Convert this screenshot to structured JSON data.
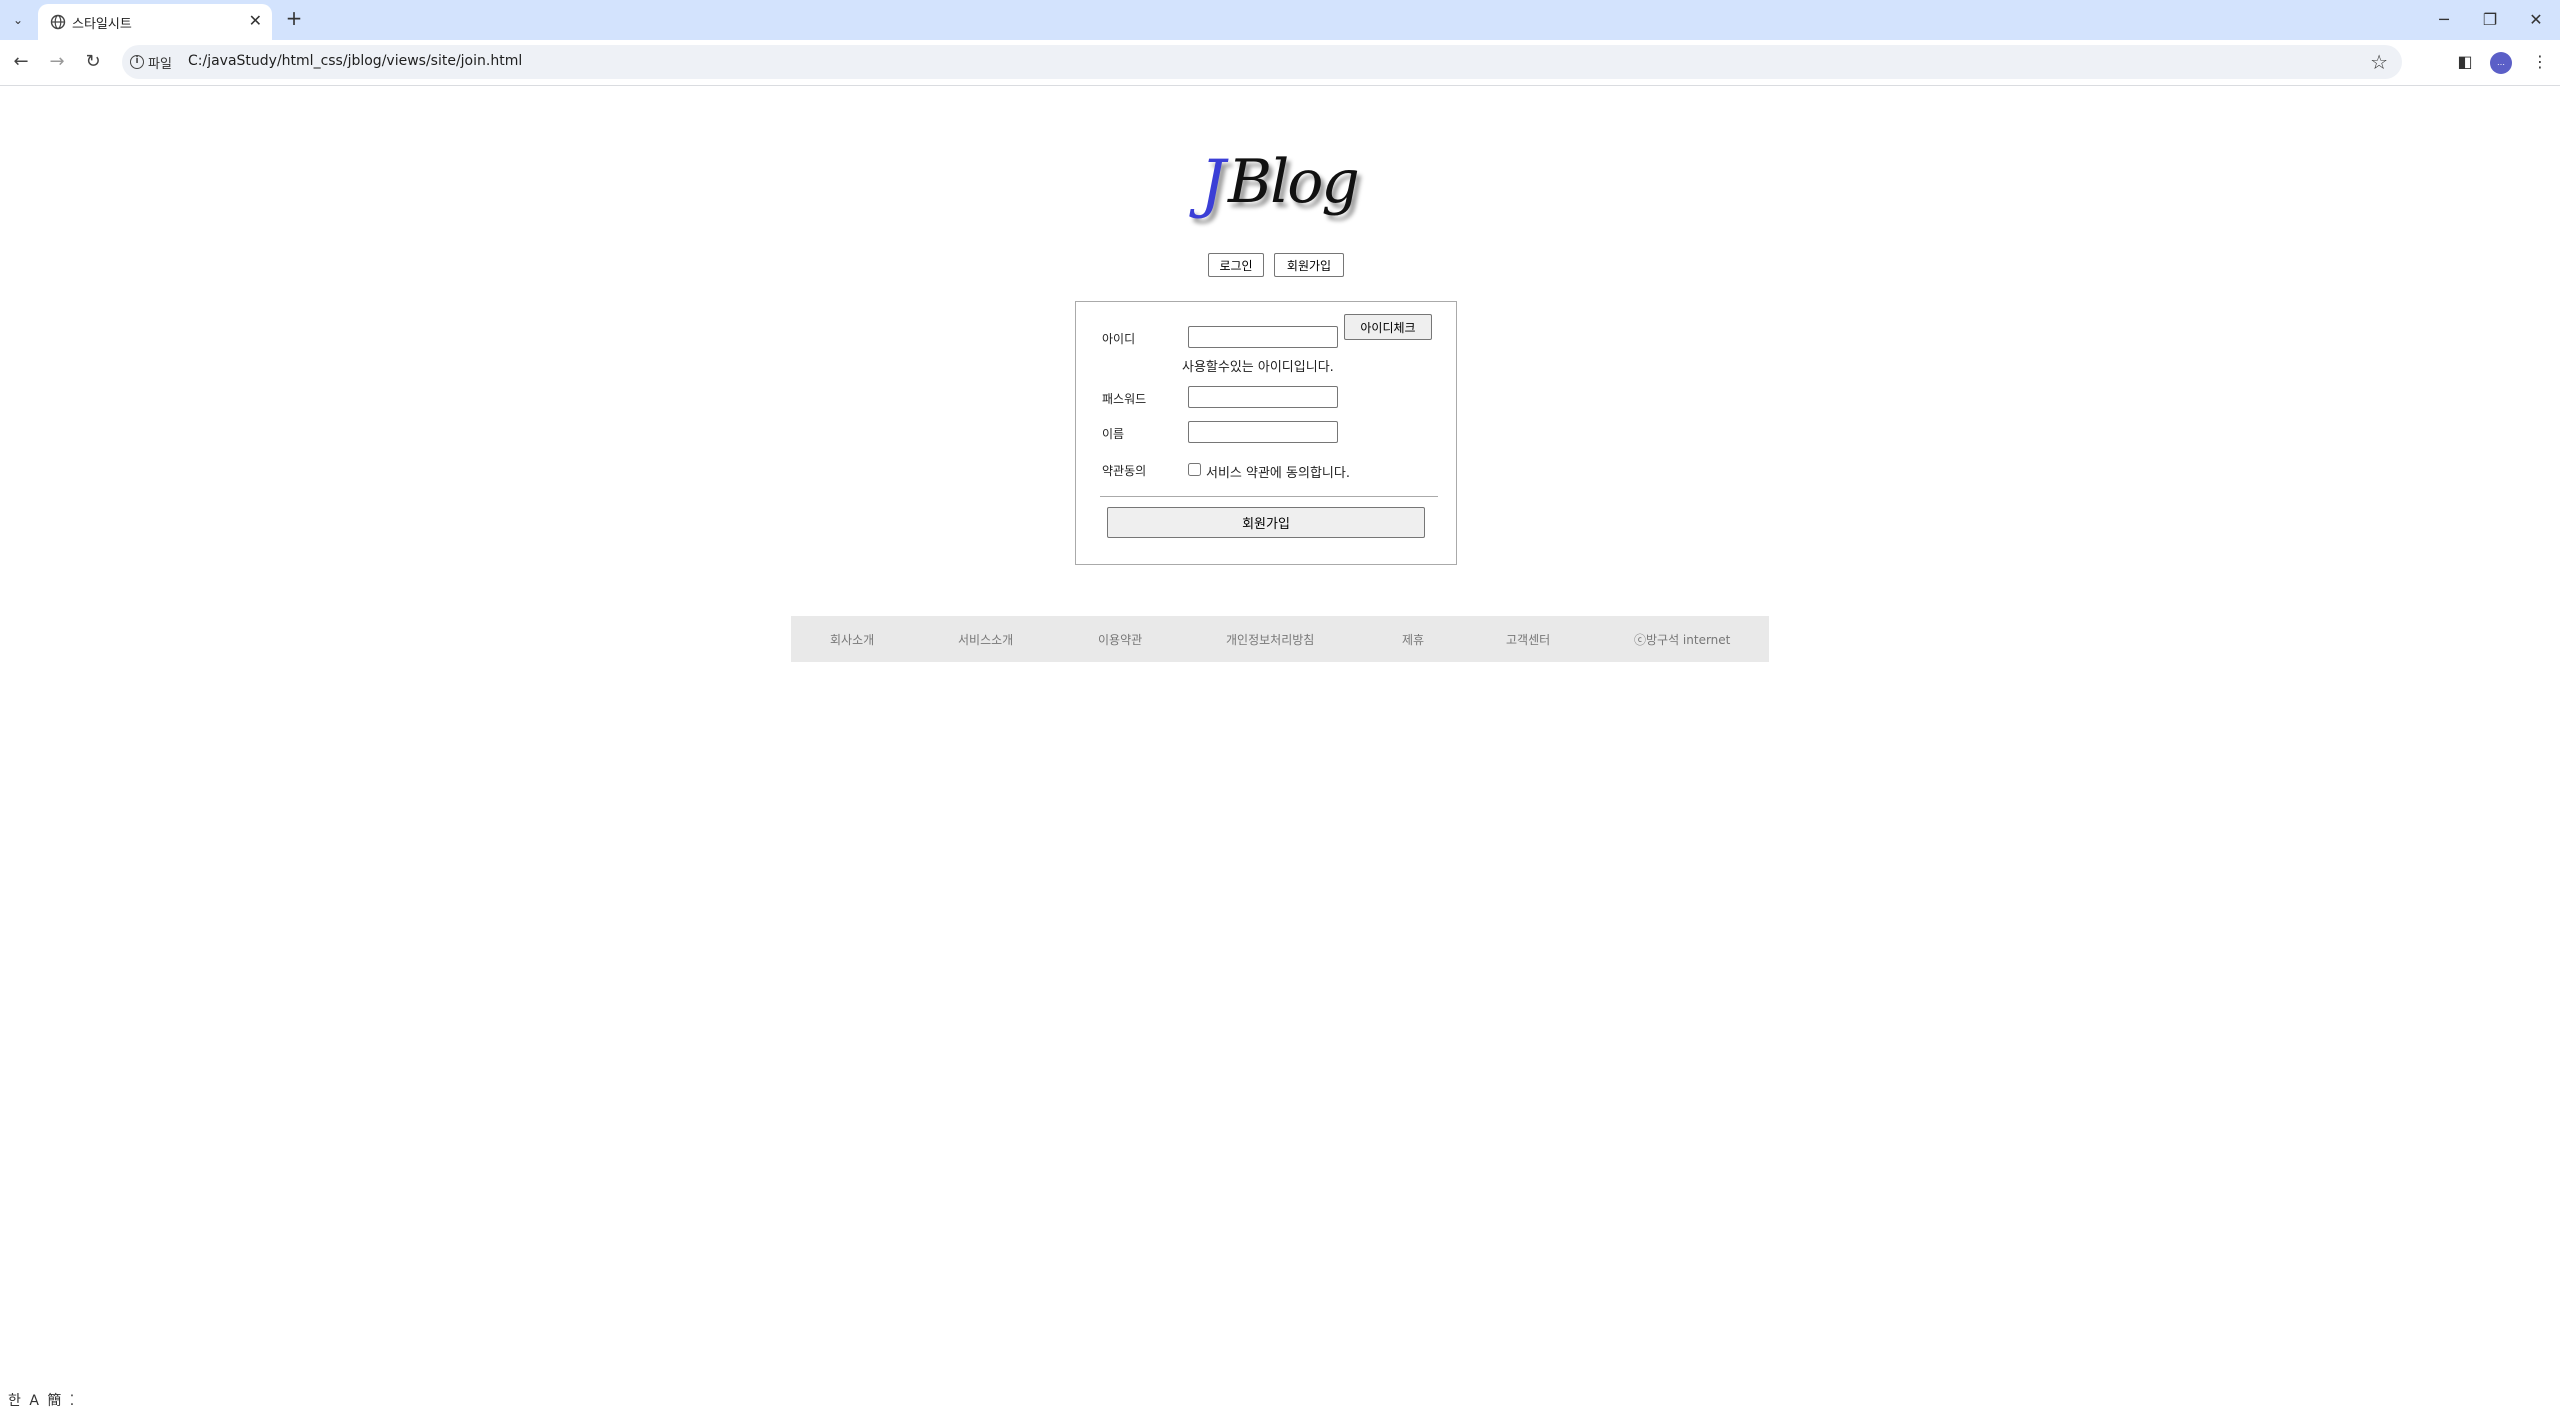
{
  "browser": {
    "tab_title": "스타일시트",
    "tab_close": "✕",
    "new_tab": "+",
    "scheme_label": "파일",
    "url": "C:/javaStudy/html_css/jblog/views/site/join.html",
    "profile_text": "…",
    "window_minimize": "─",
    "window_restore": "❐",
    "window_close": "✕"
  },
  "logo": {
    "j": "J",
    "rest": "Blog"
  },
  "menu": {
    "login": "로그인",
    "join": "회원가입"
  },
  "form": {
    "id_label": "아이디",
    "id_value": "",
    "id_check_button": "아이디체크",
    "id_message": "사용할수있는 아이디입니다.",
    "password_label": "패스워드",
    "password_value": "",
    "name_label": "이름",
    "name_value": "",
    "terms_label": "약관동의",
    "terms_checked": false,
    "terms_text": "서비스 약관에 동의합니다.",
    "submit_button": "회원가입"
  },
  "footer": {
    "items": [
      "회사소개",
      "서비스소개",
      "이용약관",
      "개인정보처리방침",
      "제휴",
      "고객센터",
      "ⓒ방구석 internet"
    ]
  },
  "ime": {
    "text": "한 A 簡 ⁚"
  }
}
